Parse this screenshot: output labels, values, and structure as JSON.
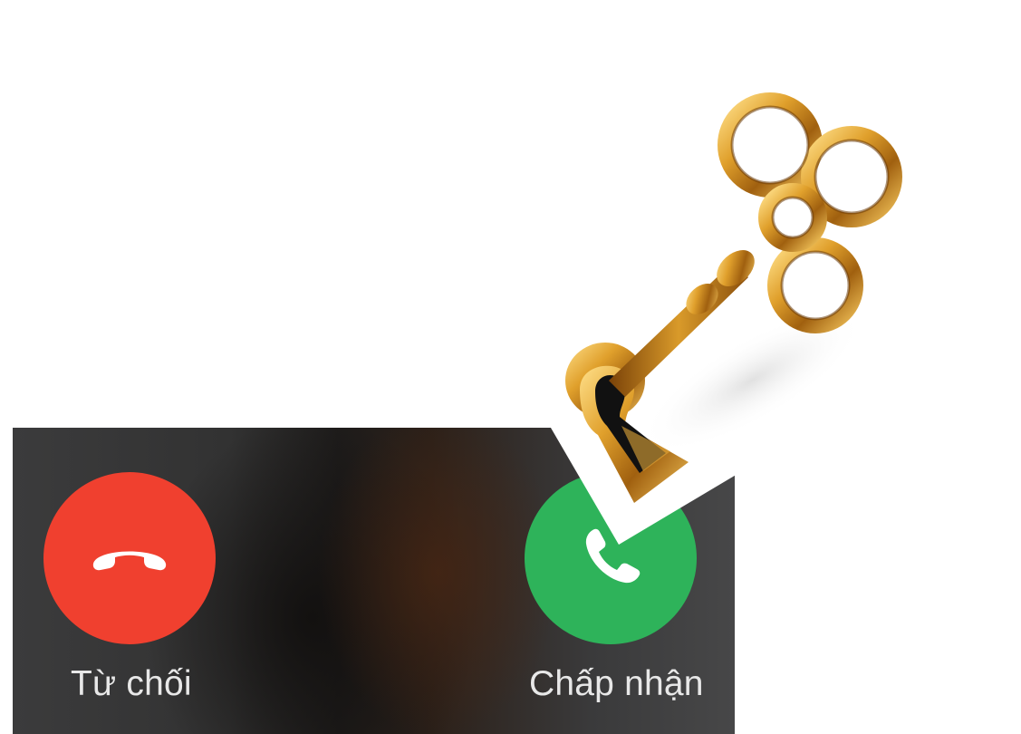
{
  "call": {
    "decline_label": "Từ chối",
    "accept_label": "Chấp nhận"
  },
  "icons": {
    "decline": "phone-hang-up-icon",
    "accept": "phone-icon",
    "overlay": "golden-key-in-keyhole"
  },
  "colors": {
    "decline": "#f0402f",
    "accept": "#2eb35a",
    "panel": "#333333",
    "label": "#e8e8e8",
    "key_gold": "#c98a1e"
  }
}
